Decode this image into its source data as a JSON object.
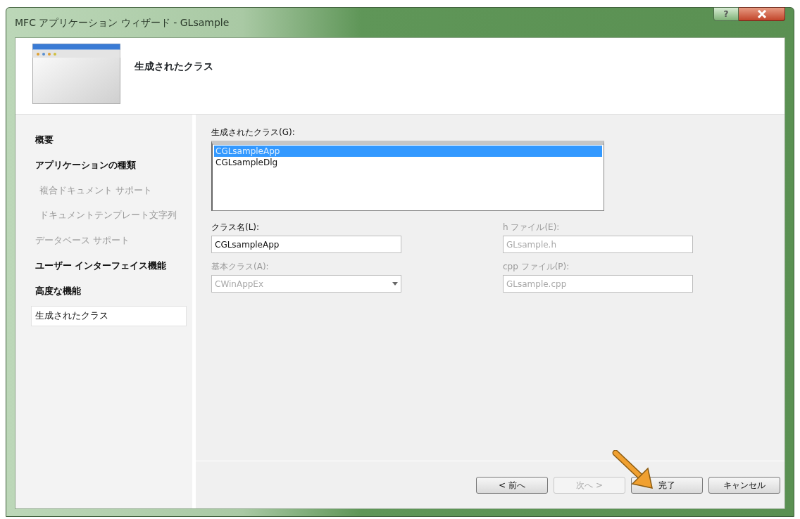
{
  "window": {
    "title": "MFC アプリケーション ウィザード - GLsample",
    "help_label": "?"
  },
  "header": {
    "title": "生成されたクラス"
  },
  "sidebar": {
    "items": [
      {
        "label": "概要",
        "disabled": false,
        "selected": false
      },
      {
        "label": "アプリケーションの種類",
        "disabled": false,
        "selected": false,
        "children": [
          {
            "label": "複合ドキュメント サポート",
            "disabled": true,
            "selected": false
          },
          {
            "label": "ドキュメントテンプレート文字列",
            "disabled": true,
            "selected": false
          }
        ]
      },
      {
        "label": "データベース サポート",
        "disabled": true,
        "selected": false
      },
      {
        "label": "ユーザー インターフェイス機能",
        "disabled": false,
        "selected": false
      },
      {
        "label": "高度な機能",
        "disabled": false,
        "selected": false
      },
      {
        "label": "生成されたクラス",
        "disabled": false,
        "selected": true
      }
    ]
  },
  "classes": {
    "label": "生成されたクラス(G):",
    "items": [
      {
        "label": "CGLsampleApp",
        "selected": true
      },
      {
        "label": "CGLsampleDlg",
        "selected": false
      }
    ]
  },
  "fields": [
    {
      "kind": "text",
      "label": "クラス名(L):",
      "value": "CGLsampleApp",
      "disabled": false
    },
    {
      "kind": "text",
      "label": "h ファイル(E):",
      "value": "GLsample.h",
      "disabled": true
    },
    {
      "kind": "dropdown",
      "label": "基本クラス(A):",
      "value": "CWinAppEx",
      "disabled": true
    },
    {
      "kind": "text",
      "label": "cpp ファイル(P):",
      "value": "GLsample.cpp",
      "disabled": true
    }
  ],
  "buttons": [
    {
      "label": "< 前へ",
      "disabled": false
    },
    {
      "label": "次へ >",
      "disabled": true
    },
    {
      "label": "完了",
      "disabled": false
    },
    {
      "label": "キャンセル",
      "disabled": false
    }
  ]
}
